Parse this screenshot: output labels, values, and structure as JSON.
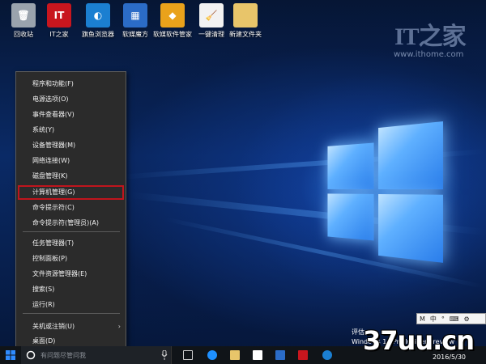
{
  "desktop_icons": [
    {
      "label": "回收站",
      "icon": "recycle-bin-icon",
      "color": "#9aa3ad",
      "glyph": "🗑"
    },
    {
      "label": "IT之家",
      "icon": "ithome-icon",
      "color": "#c8161e",
      "glyph": "IT"
    },
    {
      "label": "旗鱼浏览器",
      "icon": "sailfish-browser-icon",
      "color": "#1b7fd1",
      "glyph": "◐"
    },
    {
      "label": "软媒魔方",
      "icon": "ruanmei-mofang-icon",
      "color": "#2b6cc7",
      "glyph": "▦"
    },
    {
      "label": "软媒软件管家",
      "icon": "software-manager-icon",
      "color": "#e9a21b",
      "glyph": "◆"
    },
    {
      "label": "一键清理",
      "icon": "one-click-clean-icon",
      "color": "#f2f2f2",
      "glyph": "🧹"
    },
    {
      "label": "新建文件夹",
      "icon": "folder-icon",
      "color": "#e8c56a",
      "glyph": ""
    }
  ],
  "watermark": {
    "logo": "IT之家",
    "url": "www.ithome.com"
  },
  "winx_menu": {
    "items": [
      {
        "label": "程序和功能(F)"
      },
      {
        "label": "电源选项(O)"
      },
      {
        "label": "事件查看器(V)"
      },
      {
        "label": "系统(Y)"
      },
      {
        "label": "设备管理器(M)"
      },
      {
        "label": "网络连接(W)"
      },
      {
        "label": "磁盘管理(K)"
      },
      {
        "label": "计算机管理(G)",
        "highlighted": true
      },
      {
        "label": "命令提示符(C)"
      },
      {
        "label": "命令提示符(管理员)(A)"
      },
      {
        "label": "任务管理器(T)"
      },
      {
        "label": "控制面板(P)"
      },
      {
        "label": "文件资源管理器(E)"
      },
      {
        "label": "搜索(S)"
      },
      {
        "label": "运行(R)"
      },
      {
        "label": "关机或注销(U)",
        "has_submenu": true
      },
      {
        "label": "桌面(D)"
      }
    ],
    "highlight_color": "#c0151d"
  },
  "taskbar": {
    "search_placeholder": "有问题尽管问我",
    "apps": [
      "task-view-icon",
      "edge-icon",
      "file-explorer-icon",
      "store-icon",
      "mofang-icon",
      "ithome-icon",
      "sailfish-icon"
    ]
  },
  "tray": {
    "ime": [
      "M",
      "中",
      "°",
      "⌨",
      "⚙"
    ],
    "eval_line1": "评估",
    "eval_line2": "Windows 10 Pro Insider Preview",
    "date": "2016/5/30"
  },
  "overlay_watermark": "37uu.cn"
}
